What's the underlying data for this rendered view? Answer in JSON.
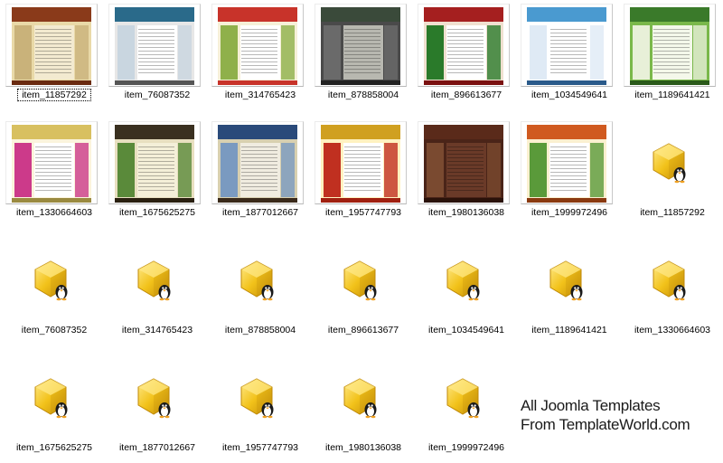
{
  "window": {
    "title": ""
  },
  "items": [
    {
      "name": "item_11857292",
      "type": "thumb",
      "selected": true,
      "colors": {
        "header": "#8a3a1a",
        "bg": "#e9d9a8",
        "side": "#c9b27a",
        "content": "#f3ead0",
        "footer": "#6a2a10"
      }
    },
    {
      "name": "item_76087352",
      "type": "thumb",
      "colors": {
        "header": "#2a6a8a",
        "bg": "#e7e7e7",
        "side": "#c9d6e0",
        "content": "#ffffff",
        "footer": "#555555"
      }
    },
    {
      "name": "item_314765423",
      "type": "thumb",
      "colors": {
        "header": "#c8332a",
        "bg": "#f6f0d8",
        "side": "#8fb04a",
        "content": "#ffffff",
        "footer": "#c8332a"
      }
    },
    {
      "name": "item_878858004",
      "type": "thumb",
      "colors": {
        "header": "#3a4a3a",
        "bg": "#4a4a4a",
        "side": "#6a6a6a",
        "content": "#b8b8b0",
        "footer": "#222222"
      }
    },
    {
      "name": "item_896613677",
      "type": "thumb",
      "colors": {
        "header": "#a51f1f",
        "bg": "#f0e0d0",
        "side": "#2a7a2a",
        "content": "#ffffff",
        "footer": "#7a1010"
      }
    },
    {
      "name": "item_1034549641",
      "type": "thumb",
      "colors": {
        "header": "#4a9ad0",
        "bg": "#ffffff",
        "side": "#dfeaf5",
        "content": "#ffffff",
        "footer": "#2a5a8a"
      }
    },
    {
      "name": "item_1189641421",
      "type": "thumb",
      "colors": {
        "header": "#3a7a2a",
        "bg": "#7ab84a",
        "side": "#e8f0d8",
        "content": "#f4f8ea",
        "footer": "#2a5a1a"
      }
    },
    {
      "name": "item_1330664603",
      "type": "thumb",
      "colors": {
        "header": "#d8c060",
        "bg": "#fbf4dc",
        "side": "#cc3a8a",
        "content": "#ffffff",
        "footer": "#9a8a40"
      }
    },
    {
      "name": "item_1675625275",
      "type": "thumb",
      "colors": {
        "header": "#3a3020",
        "bg": "#e8dfc0",
        "side": "#5a8a3a",
        "content": "#f4efd8",
        "footer": "#2a2010"
      }
    },
    {
      "name": "item_1877012667",
      "type": "thumb",
      "colors": {
        "header": "#2a4a7a",
        "bg": "#d8d0b0",
        "side": "#7a9ac0",
        "content": "#f0ece0",
        "footer": "#3a2a1a"
      }
    },
    {
      "name": "item_1957747793",
      "type": "thumb",
      "colors": {
        "header": "#d0a020",
        "bg": "#fff2c0",
        "side": "#c03020",
        "content": "#ffffff",
        "footer": "#a02010"
      }
    },
    {
      "name": "item_1980136038",
      "type": "thumb",
      "colors": {
        "header": "#5a2a1a",
        "bg": "#4a2418",
        "side": "#7a4a30",
        "content": "#6a3a28",
        "footer": "#2a120a"
      }
    },
    {
      "name": "item_1999972496",
      "type": "thumb",
      "colors": {
        "header": "#d05a20",
        "bg": "#fbf0d0",
        "side": "#5a9a3a",
        "content": "#ffffff",
        "footer": "#8a3a10"
      }
    },
    {
      "name": "item_11857292",
      "type": "icon"
    },
    {
      "name": "item_76087352",
      "type": "icon"
    },
    {
      "name": "item_314765423",
      "type": "icon"
    },
    {
      "name": "item_878858004",
      "type": "icon"
    },
    {
      "name": "item_896613677",
      "type": "icon"
    },
    {
      "name": "item_1034549641",
      "type": "icon"
    },
    {
      "name": "item_1189641421",
      "type": "icon"
    },
    {
      "name": "item_1330664603",
      "type": "icon"
    },
    {
      "name": "item_1675625275",
      "type": "icon"
    },
    {
      "name": "item_1877012667",
      "type": "icon"
    },
    {
      "name": "item_1957747793",
      "type": "icon"
    },
    {
      "name": "item_1980136038",
      "type": "icon"
    },
    {
      "name": "item_1999972496",
      "type": "icon"
    }
  ],
  "icon": {
    "name": "linux-package-icon",
    "colors": {
      "gold": "#f2c21a",
      "gold_light": "#ffe98a",
      "gold_dark": "#c08a08",
      "penguin": "#1a1a1a",
      "beak": "#f0a020"
    }
  },
  "promo": {
    "line1": "All Joomla Templates",
    "line2": "From TemplateWorld.com"
  }
}
